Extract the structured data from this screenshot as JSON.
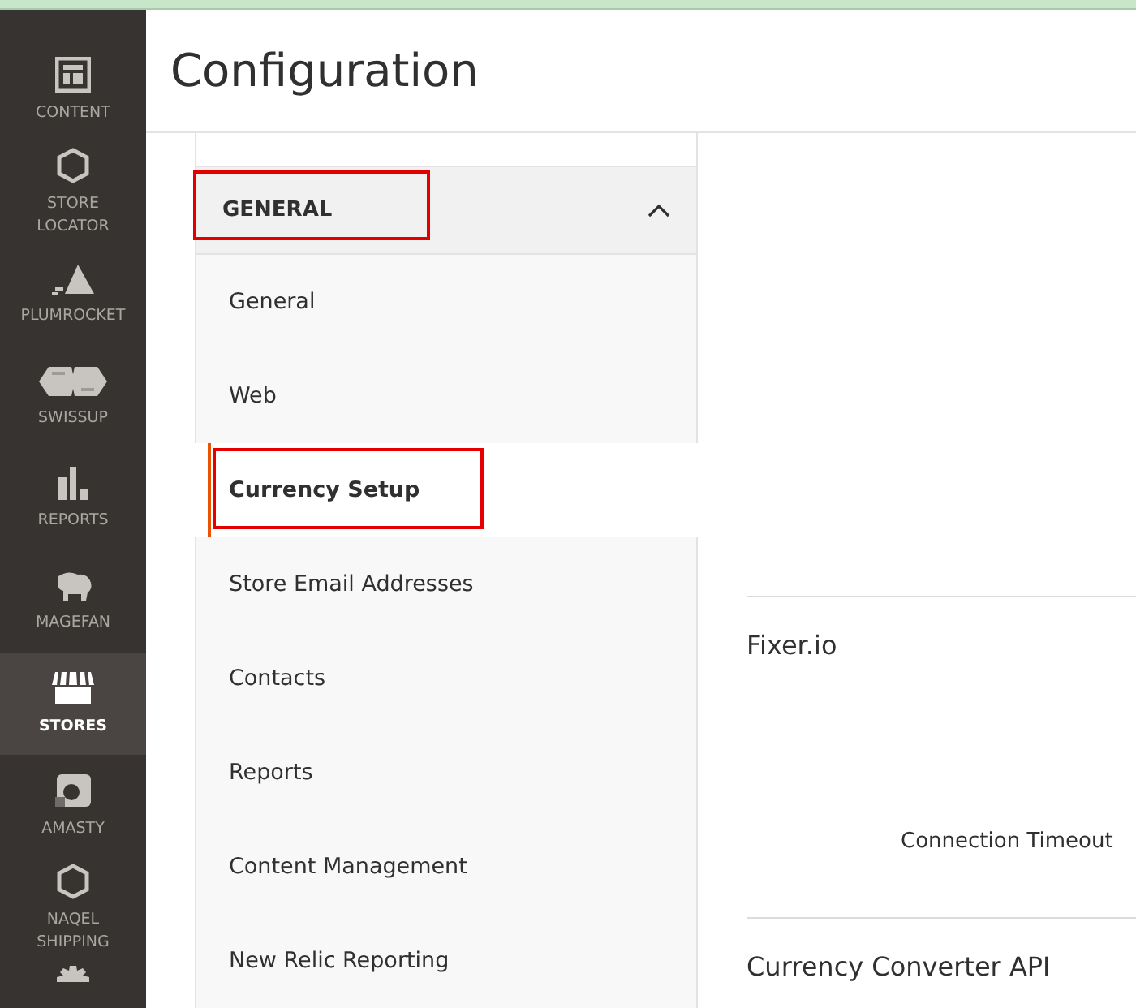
{
  "sidebar": {
    "items": [
      {
        "label": "CONTENT",
        "kind": "layout",
        "selected": false
      },
      {
        "label": "STORE\nLOCATOR",
        "kind": "hexagon",
        "selected": false
      },
      {
        "label": "PLUMROCKET",
        "kind": "pyramid",
        "selected": false
      },
      {
        "label": "SWISSUP",
        "kind": "cubes",
        "selected": false
      },
      {
        "label": "REPORTS",
        "kind": "bars",
        "selected": false
      },
      {
        "label": "MAGEFAN",
        "kind": "elephant",
        "selected": false
      },
      {
        "label": "STORES",
        "kind": "store",
        "selected": true
      },
      {
        "label": "AMASTY",
        "kind": "letter",
        "selected": false
      },
      {
        "label": "NAQEL\nSHIPPING",
        "kind": "hexagon",
        "selected": false
      }
    ]
  },
  "page": {
    "title": "Configuration"
  },
  "tabs": {
    "group": {
      "label": "GENERAL",
      "expanded": true,
      "annotated": true
    },
    "items": [
      {
        "label": "General",
        "selected": false,
        "annotated": false
      },
      {
        "label": "Web",
        "selected": false,
        "annotated": false
      },
      {
        "label": "Currency Setup",
        "selected": true,
        "annotated": true
      },
      {
        "label": "Store Email Addresses",
        "selected": false,
        "annotated": false
      },
      {
        "label": "Contacts",
        "selected": false,
        "annotated": false
      },
      {
        "label": "Reports",
        "selected": false,
        "annotated": false
      },
      {
        "label": "Content Management",
        "selected": false,
        "annotated": false
      },
      {
        "label": "New Relic Reporting",
        "selected": false,
        "annotated": false
      }
    ]
  },
  "sections": [
    {
      "title": "Fixer.io",
      "fields": [
        {
          "label": "Connection Timeout"
        }
      ]
    },
    {
      "title": "Currency Converter API"
    }
  ]
}
